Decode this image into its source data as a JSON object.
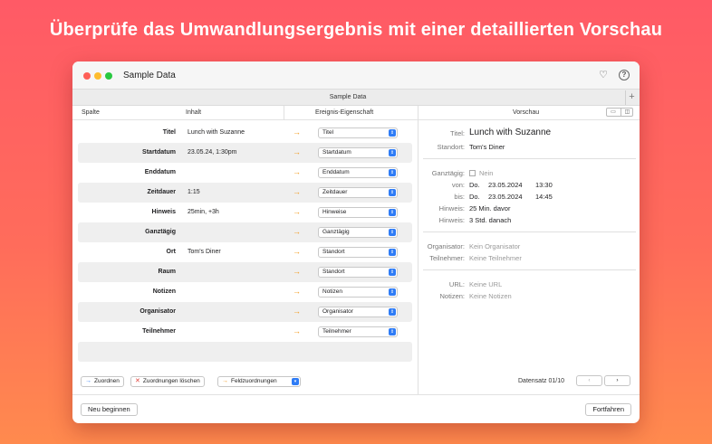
{
  "headline": "Überprüfe das Umwandlungsergebnis mit einer detaillierten Vorschau",
  "window": {
    "title": "Sample Data",
    "tab_label": "Sample Data",
    "tab_add": "+",
    "icons": {
      "heart": "heart-icon",
      "help": "?"
    }
  },
  "columns": {
    "spalte": "Spalte",
    "inhalt": "Inhalt",
    "eigenschaft": "Ereignis-Eigenschaft",
    "vorschau": "Vorschau"
  },
  "rows": [
    {
      "label": "Titel",
      "value": "Lunch with Suzanne",
      "property": "Titel"
    },
    {
      "label": "Startdatum",
      "value": "23.05.24, 1:30pm",
      "property": "Startdatum"
    },
    {
      "label": "Enddatum",
      "value": "",
      "property": "Enddatum"
    },
    {
      "label": "Zeitdauer",
      "value": "1:15",
      "property": "Zeitdauer"
    },
    {
      "label": "Hinweis",
      "value": "25min, +3h",
      "property": "Hinweise"
    },
    {
      "label": "Ganztägig",
      "value": "",
      "property": "Ganztägig"
    },
    {
      "label": "Ort",
      "value": "Tom's Diner",
      "property": "Standort"
    },
    {
      "label": "Raum",
      "value": "",
      "property": "Standort"
    },
    {
      "label": "Notizen",
      "value": "",
      "property": "Notizen"
    },
    {
      "label": "Organisator",
      "value": "",
      "property": "Organisator"
    },
    {
      "label": "Teilnehmer",
      "value": "",
      "property": "Teilnehmer"
    },
    {
      "label": "",
      "value": "",
      "property": ""
    }
  ],
  "preview": {
    "titel_k": "Titel:",
    "titel_v": "Lunch with Suzanne",
    "standort_k": "Standort:",
    "standort_v": "Tom's Diner",
    "ganztaegig_k": "Ganztägig:",
    "ganztaegig_v": "Nein",
    "von_k": "von:",
    "von_day": "Do.",
    "von_date": "23.05.2024",
    "von_time": "13:30",
    "bis_k": "bis:",
    "bis_day": "Do.",
    "bis_date": "23.05.2024",
    "bis_time": "14:45",
    "hinweis1_k": "Hinweis:",
    "hinweis1_v": "25 Min. davor",
    "hinweis2_k": "Hinweis:",
    "hinweis2_v": "3 Std. danach",
    "organisator_k": "Organisator:",
    "organisator_v": "Kein Organisator",
    "teilnehmer_k": "Teilnehmer:",
    "teilnehmer_v": "Keine Teilnehmer",
    "url_k": "URL:",
    "url_v": "Keine URL",
    "notizen_k": "Notizen:",
    "notizen_v": "Keine Notizen"
  },
  "toolbar": {
    "zuordnen": "Zuordnen",
    "zuordnungen_loeschen": "Zuordnungen löschen",
    "feldzuordnungen": "Feldzuordnungen",
    "datensatz": "Datensatz 01/10"
  },
  "footer": {
    "neu_beginnen": "Neu beginnen",
    "fortfahren": "Fortfahren"
  },
  "colors": {
    "accent_blue": "#2f7cf6",
    "arrow_orange": "#f29a1c",
    "delete_red": "#e0413a"
  }
}
